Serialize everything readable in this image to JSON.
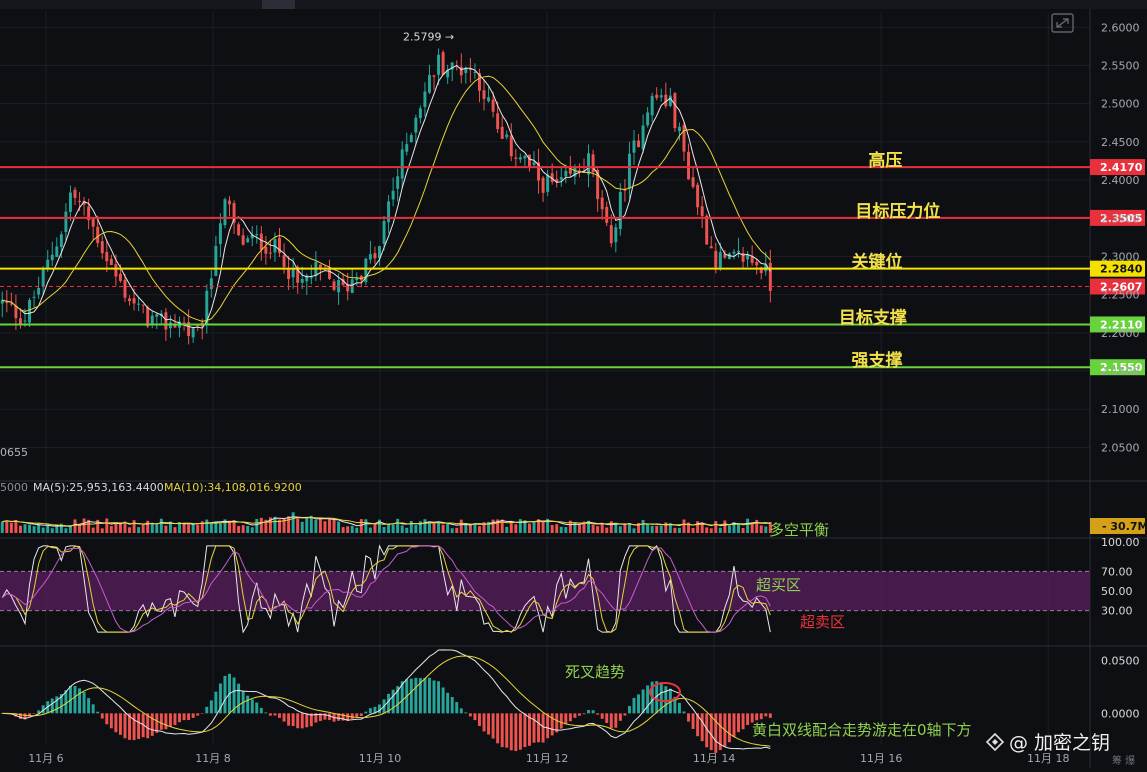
{
  "chart_data": {
    "type": "candlestick",
    "x_ticks": [
      {
        "label": "11月 6",
        "t": 0.25
      },
      {
        "label": "11月 8",
        "t": 2.25
      },
      {
        "label": "11月 10",
        "t": 4.25
      },
      {
        "label": "11月 12",
        "t": 6.25
      },
      {
        "label": "11月 14",
        "t": 8.25
      },
      {
        "label": "11月 16",
        "t": 10.25
      },
      {
        "label": "11月 18",
        "t": 12.25
      }
    ],
    "x_range_days": [
      -0.3,
      12.75
    ],
    "price_ylim": [
      2.01,
      2.62
    ],
    "price_ticks": [
      "2.0500",
      "2.1000",
      "2.1500",
      "2.2000",
      "2.2500",
      "2.3000",
      "2.3500",
      "2.4000",
      "2.4500",
      "2.5000",
      "2.5500",
      "2.6000"
    ],
    "price_path": [
      [
        -0.3,
        2.24
      ],
      [
        0.0,
        2.22
      ],
      [
        0.2,
        2.27
      ],
      [
        0.45,
        2.34
      ],
      [
        0.55,
        2.385
      ],
      [
        0.7,
        2.36
      ],
      [
        0.85,
        2.33
      ],
      [
        1.1,
        2.27
      ],
      [
        1.35,
        2.23
      ],
      [
        1.6,
        2.21
      ],
      [
        1.85,
        2.215
      ],
      [
        2.05,
        2.19
      ],
      [
        2.2,
        2.25
      ],
      [
        2.3,
        2.34
      ],
      [
        2.42,
        2.37
      ],
      [
        2.55,
        2.32
      ],
      [
        2.85,
        2.32
      ],
      [
        3.1,
        2.3
      ],
      [
        3.25,
        2.26
      ],
      [
        3.5,
        2.28
      ],
      [
        3.8,
        2.255
      ],
      [
        3.95,
        2.275
      ],
      [
        4.1,
        2.29
      ],
      [
        4.25,
        2.31
      ],
      [
        4.35,
        2.37
      ],
      [
        4.5,
        2.42
      ],
      [
        4.65,
        2.48
      ],
      [
        4.8,
        2.52
      ],
      [
        4.95,
        2.555
      ],
      [
        5.1,
        2.545
      ],
      [
        5.3,
        2.55
      ],
      [
        5.45,
        2.53
      ],
      [
        5.7,
        2.45
      ],
      [
        5.95,
        2.43
      ],
      [
        6.15,
        2.4
      ],
      [
        6.4,
        2.39
      ],
      [
        6.6,
        2.41
      ],
      [
        6.75,
        2.425
      ],
      [
        6.85,
        2.38
      ],
      [
        6.95,
        2.33
      ],
      [
        7.05,
        2.33
      ],
      [
        7.2,
        2.41
      ],
      [
        7.35,
        2.46
      ],
      [
        7.45,
        2.5
      ],
      [
        7.6,
        2.51
      ],
      [
        7.75,
        2.495
      ],
      [
        7.9,
        2.43
      ],
      [
        8.1,
        2.35
      ],
      [
        8.25,
        2.3
      ],
      [
        8.4,
        2.29
      ],
      [
        8.6,
        2.3
      ],
      [
        8.8,
        2.29
      ],
      [
        8.95,
        2.26
      ]
    ],
    "high_annotation": {
      "label": "2.5799 →",
      "t": 5.1,
      "value": 2.5799
    },
    "levels": [
      {
        "name": "高压",
        "value": 2.417,
        "label": "2.4170",
        "color": "#e8313c",
        "text_color": "#f2e14a",
        "text_t": 10.3
      },
      {
        "name": "目标压力位",
        "value": 2.3505,
        "label": "2.3505",
        "color": "#e8313c",
        "text_color": "#f2e14a",
        "text_t": 10.45
      },
      {
        "name": "关键位",
        "value": 2.284,
        "label": "2.2840",
        "color": "#f5e000",
        "text_color": "#f2e14a",
        "text_t": 10.2
      },
      {
        "name": "目标支撑",
        "value": 2.211,
        "label": "2.2110",
        "color": "#68d33c",
        "text_color": "#f2e14a",
        "text_t": 10.15
      },
      {
        "name": "强支撑",
        "value": 2.155,
        "label": "2.1550",
        "color": "#68d33c",
        "text_color": "#f2e14a",
        "text_t": 10.2
      }
    ],
    "current_price": {
      "value": 2.2607,
      "label": "2.2607",
      "color": "#e8313c"
    },
    "partial_left_label": "0655",
    "volume": {
      "left_fragment": "5000",
      "ma5_label": "MA(5):25,953,163.4400",
      "ma10_label": "MA(10):34,108,016.9200",
      "axis_badge": "30.7M",
      "annotation": "多空平衡"
    },
    "rsi": {
      "ylim": [
        0,
        100
      ],
      "ticks": [
        "100.00",
        "70.00",
        "50.00",
        "30.00"
      ],
      "overbought": 70,
      "oversold": 30,
      "overbought_label": "超买区",
      "oversold_label": "超卖区"
    },
    "macd": {
      "ticks": [
        "0.0500",
        "0.0000"
      ],
      "ylim": [
        -0.03,
        0.06
      ],
      "cross_label": "死叉趋势",
      "bottom_label": "黄白双线配合走势游走在0轴下方"
    },
    "colors": {
      "up": "#26a69a",
      "down": "#ef5350",
      "ma_white": "#e8e8e8",
      "ma_yellow": "#e6d43a",
      "rsi_band": "#5a1f5e",
      "rsi_line": "#c75cd0"
    }
  },
  "watermark": {
    "text": "@ 加密之钥"
  },
  "corner_chars": "筹 爆"
}
